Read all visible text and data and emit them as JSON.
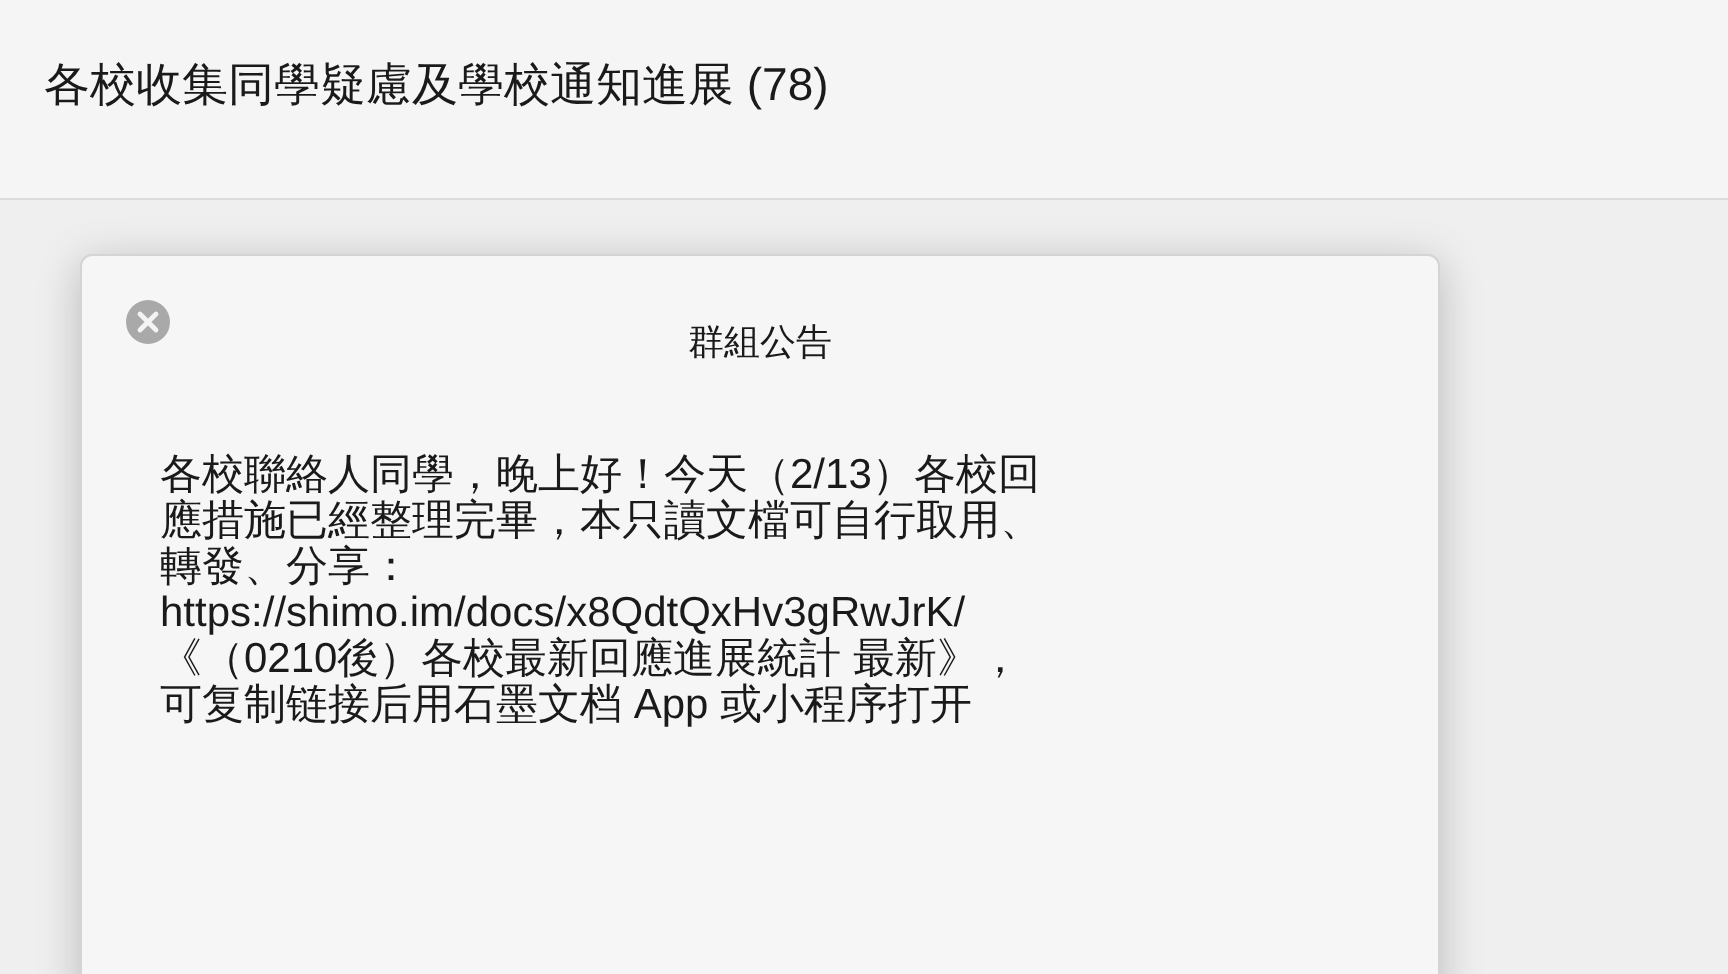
{
  "window": {
    "title": "各校收集同學疑慮及學校通知進展 (78)"
  },
  "dialog": {
    "title": "群組公告",
    "message_lines": [
      "各校聯絡人同學，晚上好！今天（2/13）各校回",
      "應措施已經整理完畢，本只讀文檔可自行取用、",
      "轉發、分享：",
      "https://shimo.im/docs/x8QdtQxHv3gRwJrK/",
      "《（0210後）各校最新回應進展統計 最新》，",
      "可复制链接后用石墨文档 App 或小程序打开"
    ]
  }
}
